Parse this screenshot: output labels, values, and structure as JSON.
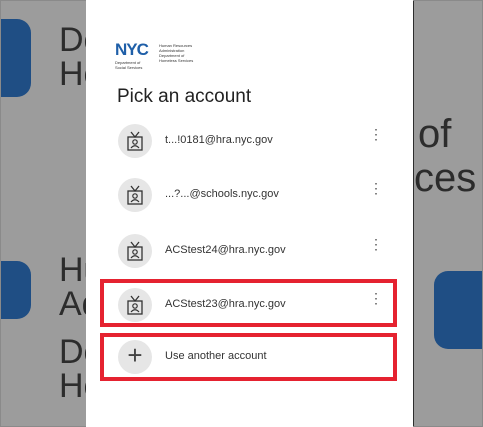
{
  "app": {
    "logo_text": "NYC",
    "logo_line1": "Human Resources Administration",
    "logo_line2": "Department of Homeless Services",
    "logo_dept": "Department of Social Services"
  },
  "dialog": {
    "title": "Pick an account",
    "accounts": [
      {
        "email": "t...!0181@hra.nyc.gov",
        "menu": "⋮"
      },
      {
        "email": "...?...@schools.nyc.gov",
        "menu": "⋮"
      },
      {
        "email": "ACStest24@hra.nyc.gov",
        "menu": "⋮"
      },
      {
        "email": "ACStest23@hra.nyc.gov",
        "menu": "⋮"
      }
    ],
    "use_another": "Use another account",
    "plus_icon": "+"
  },
  "background": {
    "left_text_1": "De",
    "left_text_2": "Hc",
    "left_text_3": "Hu",
    "left_text_4": "Ad",
    "left_text_5": "De",
    "left_text_6": "Hc",
    "right_text_1": "of",
    "right_text_2": "ces"
  },
  "colors": {
    "highlight": "#e52230",
    "brand": "#1f5fa8"
  }
}
